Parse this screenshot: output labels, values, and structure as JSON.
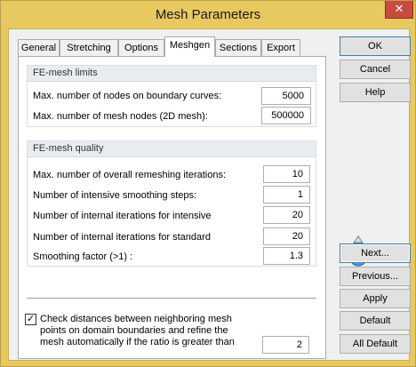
{
  "window": {
    "title": "Mesh Parameters",
    "close_glyph": "✕"
  },
  "tabs": [
    {
      "label": "General"
    },
    {
      "label": "Stretching"
    },
    {
      "label": "Options"
    },
    {
      "label": "Meshgen",
      "active": true
    },
    {
      "label": "Sections"
    },
    {
      "label": "Export"
    }
  ],
  "limits": {
    "header": "FE-mesh limits",
    "boundary_nodes_label": "Max. number of nodes on boundary curves:",
    "boundary_nodes_value": "5000",
    "mesh_nodes_label": "Max. number of mesh nodes (2D mesh):",
    "mesh_nodes_value": "500000"
  },
  "quality": {
    "header": "FE-mesh quality",
    "remeshing_label": "Max. number of overall remeshing iterations:",
    "remeshing_value": "10",
    "smoothing_steps_label": "Number of intensive smoothing steps:",
    "smoothing_steps_value": "1",
    "internal_intensive_label": "Number of internal iterations for intensive",
    "internal_intensive_value": "20",
    "internal_standard_label": "Number of internal iterations for standard",
    "internal_standard_value": "20",
    "smoothing_factor_label": "Smoothing factor (>1) :",
    "smoothing_factor_value": "1.3",
    "check_label": "Check distances between neighboring mesh points on domain boundaries and refine the mesh automatically if the ratio is greater than",
    "check_checked": true,
    "ratio_value": "2"
  },
  "buttons": {
    "ok": "OK",
    "cancel": "Cancel",
    "help": "Help",
    "next": "Next...",
    "previous": "Previous...",
    "apply": "Apply",
    "default": "Default",
    "all_default": "All Default"
  },
  "colors": {
    "frame": "#e7c95f",
    "close": "#c74b3f",
    "accent": "#3c7fb1"
  },
  "icons": {
    "mascot": "water-drop-mascot-icon",
    "check": "checkmark-icon"
  }
}
